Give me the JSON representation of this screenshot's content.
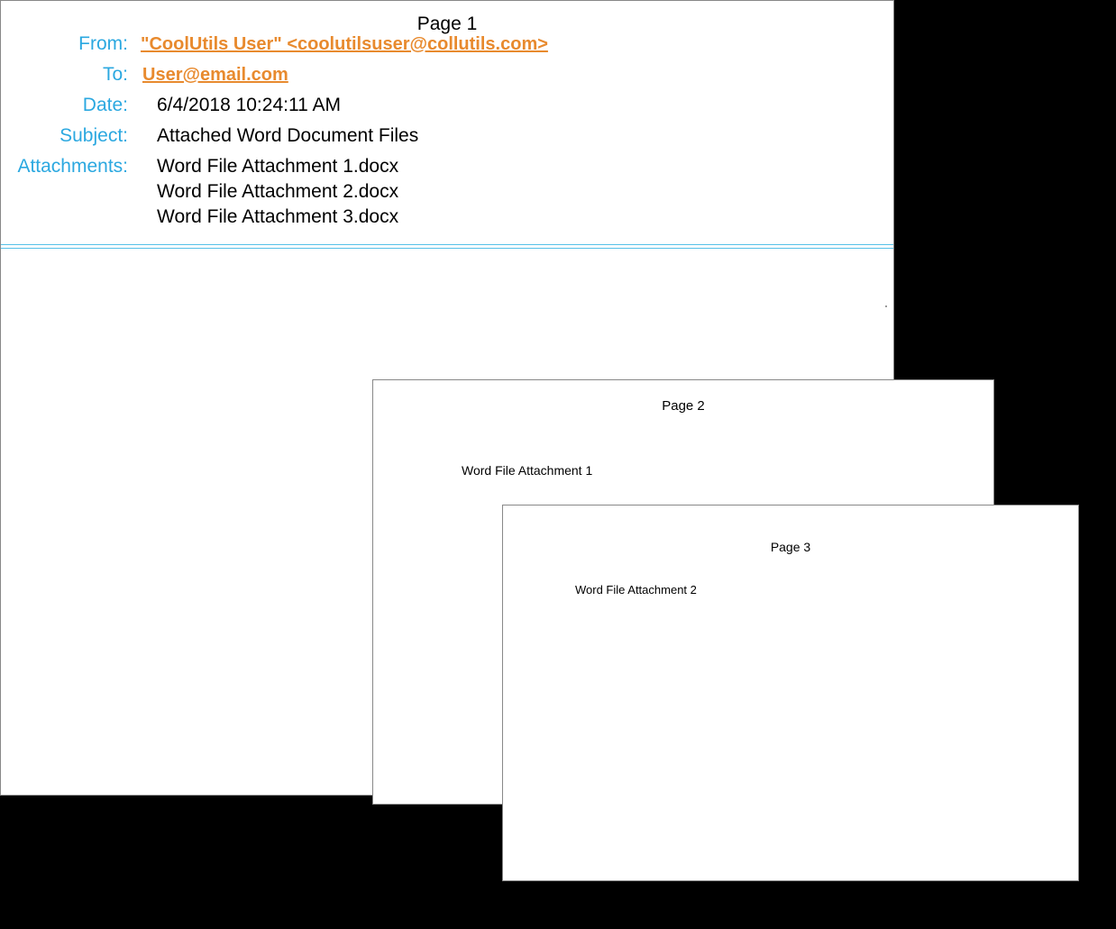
{
  "page1": {
    "label": "Page 1",
    "from_label": "From:",
    "from_value": "\"CoolUtils User\" <coolutilsuser@collutils.com>",
    "to_label": "To:",
    "to_value": "User@email.com",
    "date_label": "Date:",
    "date_value": "6/4/2018 10:24:11 AM",
    "subject_label": "Subject:",
    "subject_value": "Attached Word Document Files",
    "attachments_label": "Attachments:",
    "attachments": [
      "Word File Attachment 1.docx",
      "Word File Attachment 2.docx",
      "Word File Attachment 3.docx"
    ]
  },
  "page2": {
    "label": "Page 2",
    "content": "Word File Attachment 1"
  },
  "page3": {
    "label": "Page 3",
    "content": "Word File Attachment 2"
  }
}
